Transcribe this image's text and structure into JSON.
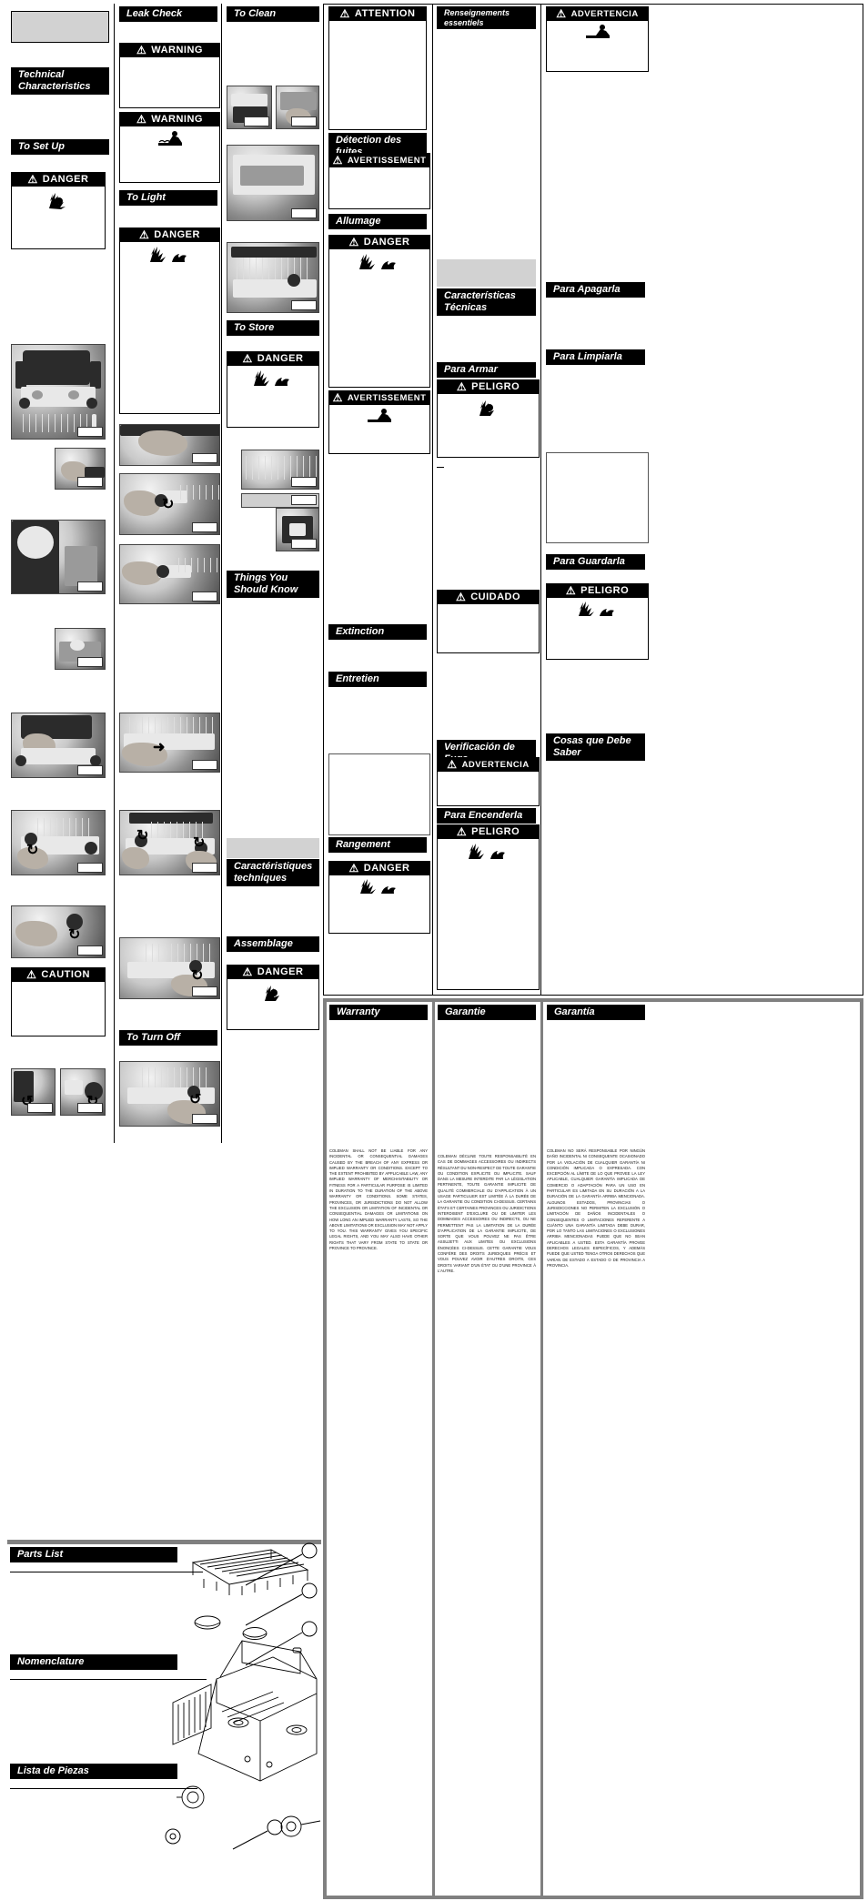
{
  "document": {
    "type": "trilingual-appliance-instruction-sheet",
    "product": "portable propane camping stove"
  },
  "columns": {
    "english_left": {
      "sections": [
        {
          "name": "technical-characteristics",
          "label": "Technical\nCharacteristics"
        },
        {
          "name": "to-set-up",
          "label": "To Set Up"
        },
        {
          "name": "parts-list",
          "label": "Parts List"
        }
      ],
      "signal_words": [
        {
          "name": "danger-set-up",
          "label": "DANGER",
          "pictogram": "explosion-fire-icon"
        },
        {
          "name": "caution-set-up",
          "label": "CAUTION",
          "pictogram": "none"
        }
      ]
    },
    "english_mid": {
      "sections": [
        {
          "name": "leak-check",
          "label": "Leak Check"
        },
        {
          "name": "to-light",
          "label": "To Light"
        },
        {
          "name": "to-turn-off",
          "label": "To Turn Off"
        }
      ],
      "signal_words": [
        {
          "name": "warning-leak-check-1",
          "label": "WARNING",
          "pictogram": "none"
        },
        {
          "name": "warning-leak-check-2",
          "label": "WARNING",
          "pictogram": "co-poison-icon"
        },
        {
          "name": "danger-to-light",
          "label": "DANGER",
          "pictogram": "explosion-fire-icon"
        }
      ]
    },
    "english_right": {
      "sections": [
        {
          "name": "to-clean",
          "label": "To Clean"
        },
        {
          "name": "to-store",
          "label": "To Store"
        },
        {
          "name": "things-you-should-know",
          "label": "Things You Should Know"
        }
      ],
      "signal_words": [
        {
          "name": "danger-to-store",
          "label": "DANGER",
          "pictogram": "explosion-fire-icon"
        }
      ]
    },
    "french": {
      "sections": [
        {
          "name": "detection-des-fuites",
          "label": "Détection des fuites"
        },
        {
          "name": "allumage",
          "label": "Allumage"
        },
        {
          "name": "extinction",
          "label": "Extinction"
        },
        {
          "name": "entretien",
          "label": "Entretien"
        },
        {
          "name": "rangement",
          "label": "Rangement"
        },
        {
          "name": "caracteristiques-techniques",
          "label": "Caractéristiques\ntechniques"
        },
        {
          "name": "assemblage",
          "label": "Assemblage"
        },
        {
          "name": "nomenclature",
          "label": "Nomenclature"
        }
      ],
      "signal_words": [
        {
          "name": "attention-fr",
          "label": "ATTENTION",
          "pictogram": "none"
        },
        {
          "name": "avertissement-fuites",
          "label": "AVERTISSEMENT",
          "pictogram": "none"
        },
        {
          "name": "danger-allumage",
          "label": "DANGER",
          "pictogram": "explosion-fire-icon"
        },
        {
          "name": "danger-rangement",
          "label": "DANGER",
          "pictogram": "explosion-fire-icon"
        },
        {
          "name": "avertissement-entretien",
          "label": "AVERTISSEMENT",
          "pictogram": "co-poison-icon"
        },
        {
          "name": "danger-assemblage",
          "label": "DANGER",
          "pictogram": "explosion-fire-icon"
        }
      ]
    },
    "spanish_mid": {
      "sections": [
        {
          "name": "renseignements-essentiels",
          "label": "Renseignements essentiels"
        },
        {
          "name": "caracteristicas-tecnicas",
          "label": "Características\nTécnicas"
        },
        {
          "name": "para-armar",
          "label": "Para Armar"
        },
        {
          "name": "verificacion-de-fuga",
          "label": "Verificación de Fuga"
        },
        {
          "name": "para-encenderla",
          "label": "Para Encenderla"
        }
      ],
      "signal_words": [
        {
          "name": "peligro-para-armar",
          "label": "PELIGRO",
          "pictogram": "explosion-fire-icon"
        },
        {
          "name": "cuidado",
          "label": "CUIDADO",
          "pictogram": "none"
        },
        {
          "name": "advertencia-fuga",
          "label": "ADVERTENCIA",
          "pictogram": "none"
        },
        {
          "name": "peligro-encender",
          "label": "PELIGRO",
          "pictogram": "explosion-fire-icon"
        }
      ]
    },
    "spanish_right": {
      "sections": [
        {
          "name": "para-apagarla",
          "label": "Para Apagarla"
        },
        {
          "name": "para-limpiarla",
          "label": "Para Limpiarla"
        },
        {
          "name": "para-guardarla",
          "label": "Para Guardarla"
        },
        {
          "name": "cosas-que-debe-saber",
          "label": "Cosas que Debe Saber"
        },
        {
          "name": "lista-de-piezas",
          "label": "Lista de Piezas"
        }
      ],
      "signal_words": [
        {
          "name": "advertencia-top",
          "label": "ADVERTENCIA",
          "pictogram": "co-poison-icon"
        },
        {
          "name": "peligro-guardar",
          "label": "PELIGRO",
          "pictogram": "explosion-fire-icon"
        }
      ]
    }
  },
  "warranty": {
    "en": {
      "heading": "Warranty",
      "body": "COLEMAN SHALL NOT BE LIABLE FOR ANY INCIDENTAL OR CONSEQUENTIAL DAMAGES CAUSED BY THE BREACH OF ANY EXPRESS OR IMPLIED WARRANTY OR CONDITIONS. EXCEPT TO THE EXTENT PROHIBITED BY APPLICABLE LAW, ANY IMPLIED WARRANTY OF MERCHANTABILITY OR FITNESS FOR A PARTICULAR PURPOSE IS LIMITED IN DURATION TO THE DURATION OF THE ABOVE WARRANTY OR CONDITIONS. SOME STATES, PROVINCES, OR JURISDICTIONS DO NOT ALLOW THE EXCLUSION OR LIMITATION OF INCIDENTAL OR CONSEQUENTIAL DAMAGES OR LIMITATIONS ON HOW LONG AN IMPLIED WARRANTY LASTS, SO THE ABOVE LIMITATIONS OR EXCLUSION MAY NOT APPLY TO YOU. THIS WARRANTY GIVES YOU SPECIFIC LEGAL RIGHTS, AND YOU MAY ALSO HAVE OTHER RIGHTS THAT VARY FROM STATE TO STATE OR PROVINCE TO PROVINCE."
    },
    "fr": {
      "heading": "Garantie",
      "body": "COLEMAN DÉCLINE TOUTE RESPONSABILITÉ EN CAS DE DOMMAGES ACCESSOIRES OU INDIRECTS RÉSULTANT DU NON-RESPECT DE TOUTE GARANTIE OU CONDITION EXPLICITE OU IMPLICITE. SAUF DANS LA MESURE INTERDITE PAR LA LÉGISLATION PERTINENTE, TOUTE GARANTIE IMPLICITE DE QUALITÉ COMMERCIALE OU D'APPLICATION À UN USAGE PARTICULIER EST LIMITÉE À LA DURÉE DE LA GARANTIE OU CONDITION CI-DESSUS. CERTAINS ÉTATS ET CERTAINES PROVINCES OU JURIDICTIONS INTERDISENT D'EXCLURE OU DE LIMITER LES DOMMAGES ACCESSOIRES OU INDIRECTS, OU NE PERMETTENT PAS LA LIMITATION DE LA DURÉE D'APPLICATION DE LA GARANTIE IMPLICITE, DE SORTE QUE VOUS POUVEZ NE PAS ÊTRE ASSUJETTI AUX LIMITES OU EXCLUSIONS ÉNONCÉES CI-DESSUS. CETTE GARANTIE VOUS CONFÈRE DES DROITS JURIDIQUES PRÉCIS ET VOUS POUVEZ AVOIR D'AUTRES DROITS, CES DROITS VARIANT D'UN ÉTAT OU D'UNE PROVINCE À L'AUTRE."
    },
    "es": {
      "heading": "Garantía",
      "body": "COLEMAN NO SERÁ RESPONSABLE POR NINGÚN DAÑO INCIDENTAL NI CONSEQUENTE OCASIONADO POR LA VIOLACIÓN DE CUALQUIER GARANTÍA NI CONDICIÓN IMPLICADA O EXPRESADA. CON EXCEPCIÓN AL LÍMITE DE LO QUE PROVEE LA LEY APLICABLE, CUALQUIER GARANTÍA IMPLICADA DE COMERCIO O ADAPTACIÓN PARA UN USO EN PARTICULAR ES LIMITADA EN SU DURACIÓN A LA DURACIÓN DE LA GARANTÍA ARRIBA MENCIONADA. ALGUNOS ESTADOS, PROVINCIAS O JURISDICCIONES NO PERMITEN LA EXCLUSIÓN O LIMITACIÓN DE DAÑOS INCIDENTALES O CONSEQUENTES O LIMITACIONES REFERENTE A CUÁNTO UNA GARANTÍA LIMITADA DEBE DURAR, POR LO TANTO LAS LIMITACIONES O EXCLUSIONES ARRIBA MENCIONADAS PUEDE QUE NO SEAN APLICABLES A USTED. ESTA GARANTÍA PROVEE DERECHOS LEGALES ESPECÍFICOS, Y ADEMÁS PUEDE QUE USTED TENGA OTROS DERECHOS QUE VARÍAN DE ESTADO A ESTADO O DE PROVINCIA A PROVINCIA."
    }
  },
  "icons": {
    "warning_triangle": "⚠",
    "explosion": "✺",
    "flame": "◣",
    "co_person": "☠"
  }
}
